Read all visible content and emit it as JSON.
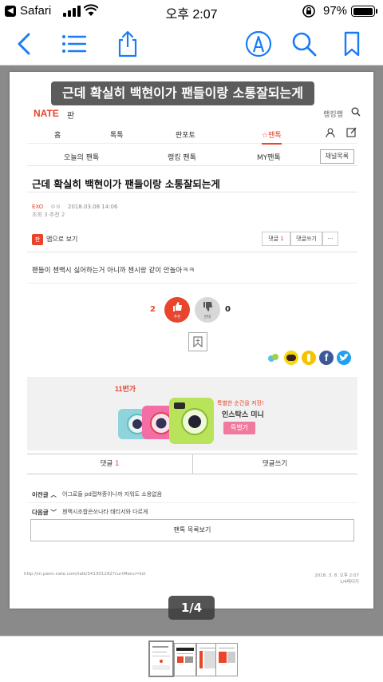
{
  "status_bar": {
    "back_app": "Safari",
    "time": "오후 2:07",
    "battery": "97%",
    "battery_level": 0.97
  },
  "toolbar": {
    "icons": [
      "back-chevron-icon",
      "list-icon",
      "share-icon",
      "markup-pen-icon",
      "search-icon",
      "bookmark-icon"
    ]
  },
  "document": {
    "overlay_title": "근데 확실히 백현이가 팬들이랑 소통잘되는게",
    "site": {
      "logo": "NATE",
      "section": "판",
      "right_link": "랭킹랭"
    },
    "nav_main": [
      "홈",
      "톡톡",
      "판포토",
      "☆팬톡"
    ],
    "nav_sub": [
      "오늘의 팬톡",
      "랭킹 팬톡",
      "MY팬톡"
    ],
    "channel_list_button": "채널목록",
    "post": {
      "title": "근데 확실히 백현이가 팬들이랑 소통잘되는게",
      "channel": "EXO",
      "author": "ㅇㅇ",
      "datetime": "2018.03.08 14:06",
      "views_likes": "조회 3    추천 2",
      "app_view": "앱으로 보기",
      "comment_label": "댓글",
      "comment_count": "1",
      "write_comment": "댓글쓰기",
      "more": "···",
      "body": "팬들이 첸백시 싫어하는거 아니까 첸시랑 같이 안놀아ㅋㅋ",
      "up_count": "2",
      "up_label": "추천",
      "down_label": "반대",
      "down_count": "0"
    },
    "banner": {
      "shop": "11번가",
      "tagline": "특별한 순간을 저장!",
      "product": "인스탁스 미니",
      "cta": "특별가"
    },
    "bottom_tabs": {
      "comments": "댓글",
      "comments_count": "1",
      "write": "댓글쓰기"
    },
    "prev": {
      "label": "이전글",
      "text": "어그로들 pd캡쳐중이니까 지워도 소용없음"
    },
    "next": {
      "label": "다음글",
      "text": "첸백시조합은쏘나타 태티서와 다르게"
    },
    "list_button": "팬톡 목록보기",
    "footer": {
      "url": "http://m.pann.nate.com/talk/341301292?currMenu=list",
      "date": "2018. 3. 8. 오후 2:07",
      "page": "1/4페이지"
    }
  },
  "page_indicator": "1/4",
  "thumbnails": {
    "count": 4,
    "selected_index": 0
  },
  "colors": {
    "accent_blue": "#1a7cf5",
    "nate_red": "#e8452c",
    "banner_pink": "#f07a9e"
  }
}
